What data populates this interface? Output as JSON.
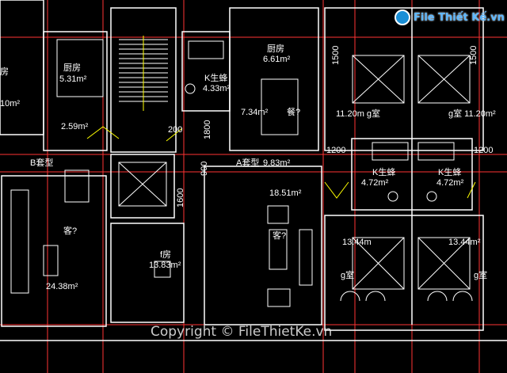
{
  "brand": {
    "logo_text": "File Thiết Kế.vn",
    "watermark": "Copyright © FileThietKe.vn"
  },
  "colors": {
    "wall": "#ffffff",
    "axis": "#ff3333",
    "furniture": "#ffffff",
    "dim": "#ffff00",
    "cyan": "#00ffff"
  },
  "rooms": {
    "kitchen_left_name": "厨房",
    "kitchen_left_area": "5.31m²",
    "bed_left_partial": "10m²",
    "left_room_partial": "房",
    "bath_top_name": "K生蜂",
    "bath_top_area": "4.33m²",
    "kitchen_mid_name": "厨房",
    "kitchen_mid_area": "6.61m²",
    "dining_area": "7.34m²",
    "dining_name": "餐?",
    "corridor_area": "2.59m²",
    "unit_b": "B套型",
    "unit_a": "A套型",
    "unit_a_area": "9.83m²",
    "living_left_name": "客?",
    "living_left_area": "24.38m²",
    "store_name": "f房",
    "store_area": "13.83m²",
    "living_mid_area": "18.51m²",
    "living_mid_name": "客?",
    "bed_r1_label": "11.20m g室",
    "bed_r2_label": "g室 11.20m²",
    "bath_r1_name": "K生蜂",
    "bath_r1_area": "4.72m²",
    "bath_r2_name": "K生蜂",
    "bath_r2_area": "4.72m²",
    "bed_r3_area": "13.44m",
    "bed_r3_name": "g室",
    "bed_r4_area": "13.44m²",
    "bed_r4_name": "g室"
  },
  "dimensions": {
    "d1500a": "1500",
    "d1500b": "1500",
    "d1200a": "1200",
    "d1200b": "1200",
    "d200": "200",
    "d1800": "1800",
    "d900": "900",
    "d1600": "1600"
  }
}
